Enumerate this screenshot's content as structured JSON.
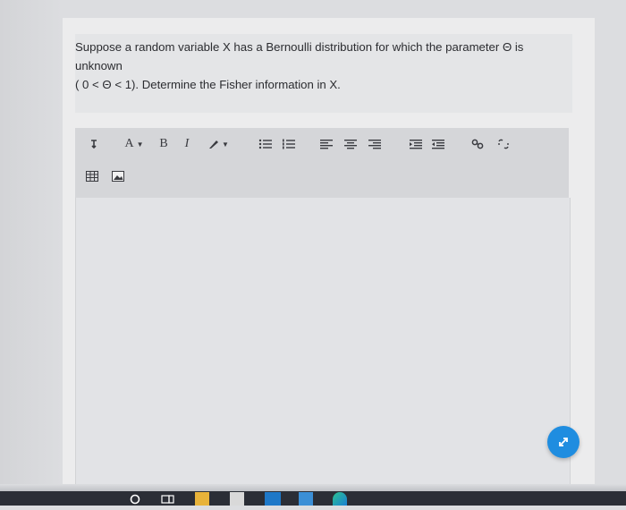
{
  "question": {
    "line1": "Suppose a random variable X has a Bernoulli distribution for which the parameter Θ is unknown",
    "line2": "( 0 < Θ < 1). Determine the Fisher information in X."
  },
  "toolbar": {
    "font_size_label": "A",
    "bold_label": "B",
    "italic_label": "I",
    "icons": [
      "paragraph-icon",
      "font-size-icon",
      "bold-icon",
      "italic-icon",
      "text-color-icon",
      "unordered-list-icon",
      "ordered-list-icon",
      "align-left-icon",
      "align-center-icon",
      "align-right-icon",
      "indent-icon",
      "outdent-icon",
      "link-icon",
      "unlink-icon",
      "table-icon",
      "image-icon"
    ]
  },
  "editor": {
    "value": ""
  },
  "fab": {
    "icon": "expand-icon",
    "color": "#1f8de0"
  },
  "taskbar": {
    "icons": [
      "search-icon",
      "task-view-icon",
      "file-explorer-icon",
      "store-icon",
      "mail-icon",
      "app-icon",
      "edge-icon"
    ]
  }
}
